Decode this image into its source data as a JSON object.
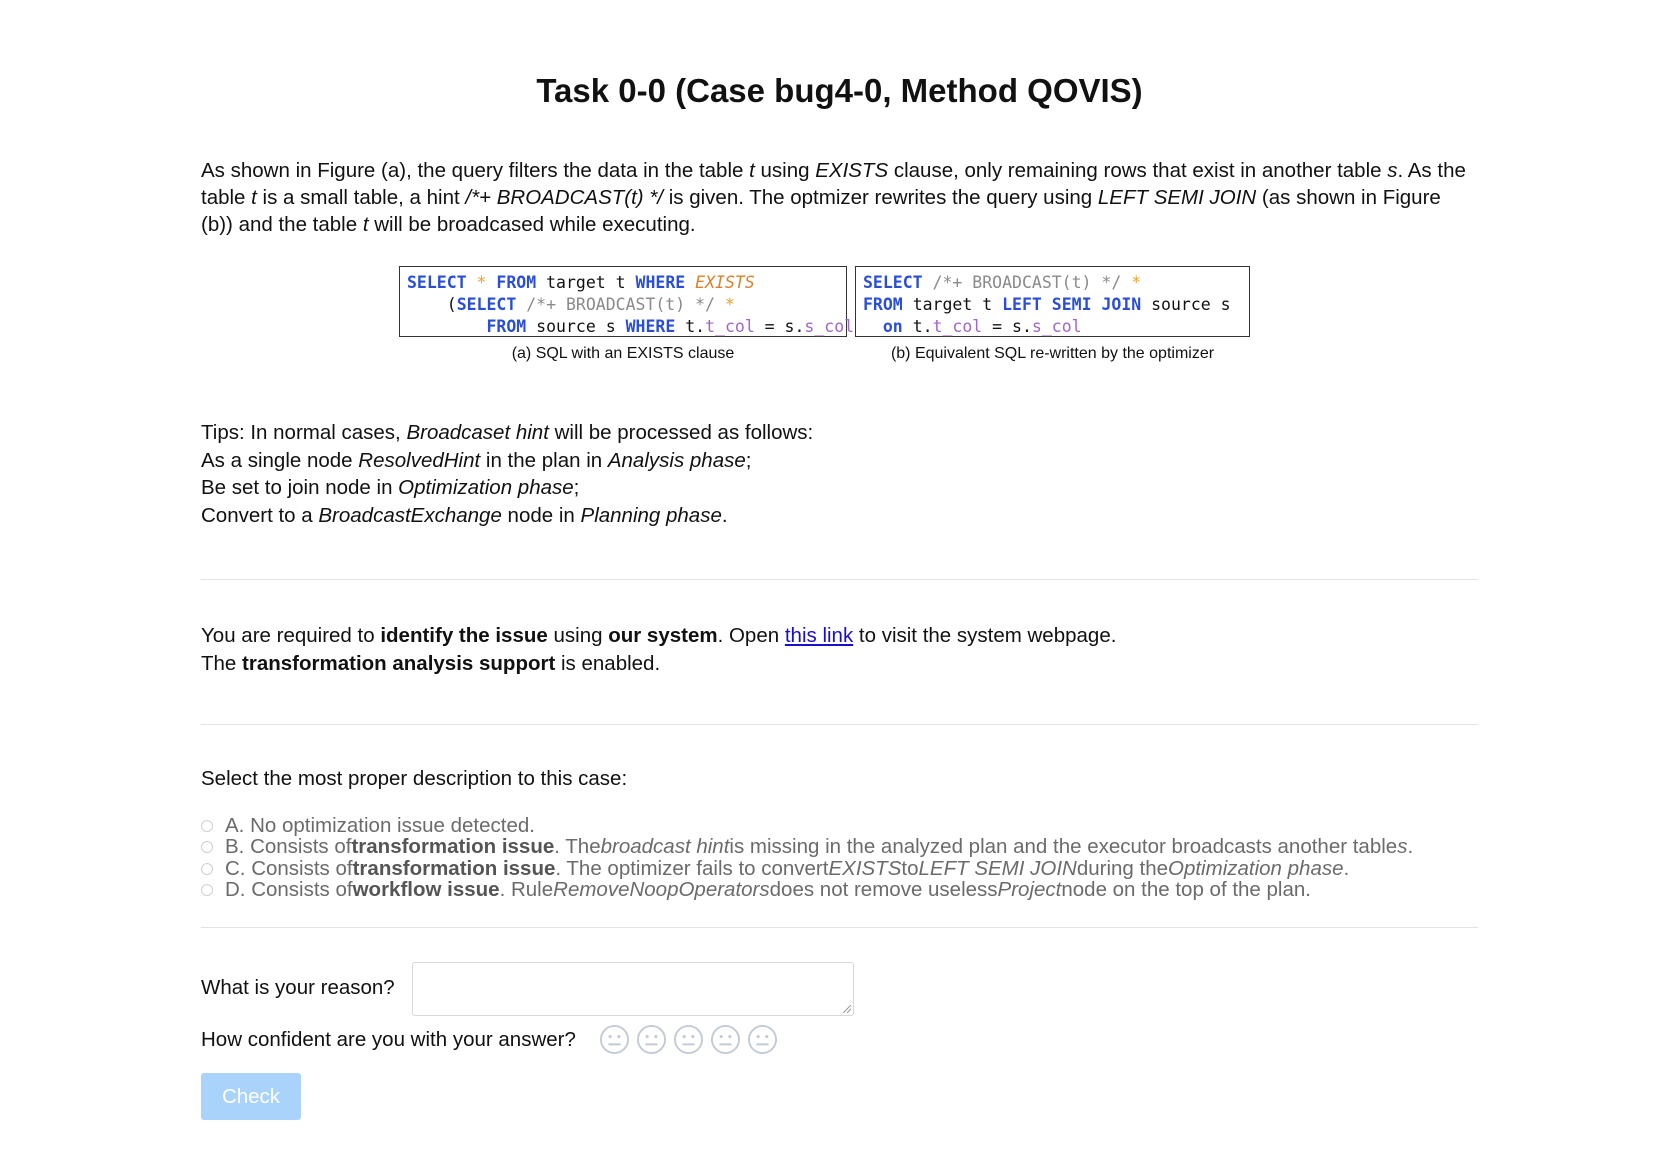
{
  "title": "Task 0-0 (Case bug4-0, Method QOVIS)",
  "intro": {
    "p1": "As shown in Figure (a), the query filters the data in the table ",
    "t1": "t",
    "p2": " using ",
    "exists": "EXISTS",
    "p3": " clause, only remaining rows that exist in another table ",
    "s1": "s",
    "p4": ". As the table ",
    "t2": "t",
    "p5": " is a small table, a hint ",
    "hint": "/*+ BROADCAST(t) */",
    "p6": " is given. The optmizer rewrites the query using ",
    "lsj": "LEFT SEMI JOIN",
    "p7": " (as shown in Figure (b)) and the table ",
    "t3": "t",
    "p8": " will be broadcased while executing."
  },
  "figures": {
    "a": {
      "caption": "(a) SQL with an EXISTS clause",
      "l1_select": "SELECT",
      "l1_star": "*",
      "l1_from": "FROM",
      "l1_target": "target t",
      "l1_where": "WHERE",
      "l1_exists": "EXISTS",
      "l2_open": "(",
      "l2_select": "SELECT",
      "l2_hint": "/*+ BROADCAST(t) */",
      "l2_star": "*",
      "l3_from": "FROM",
      "l3_source": "source s",
      "l3_where": "WHERE",
      "l3_t": "t.",
      "l3_tcol": "t_col",
      "l3_eq": " = s.",
      "l3_scol": "s_col",
      "l3_close": ")"
    },
    "b": {
      "caption": "(b) Equivalent SQL re-written by the optimizer",
      "l1_select": "SELECT",
      "l1_hint": "/*+ BROADCAST(t) */",
      "l1_star": "*",
      "l2_from": "FROM",
      "l2_target": "target t",
      "l2_lsj": "LEFT SEMI JOIN",
      "l2_source": "source s",
      "l3_on": "on",
      "l3_t": "t.",
      "l3_tcol": "t_col",
      "l3_eq": " = s.",
      "l3_scol": "s_col"
    }
  },
  "tips": {
    "l1a": "Tips: In normal cases, ",
    "l1b": "Broadcaset hint",
    "l1c": " will be processed as follows:",
    "l2a": "As a single node ",
    "l2b": "ResolvedHint",
    "l2c": " in the plan in ",
    "l2d": "Analysis phase",
    "l2e": ";",
    "l3a": "Be set to join node in ",
    "l3b": "Optimization phase",
    "l3c": ";",
    "l4a": "Convert to a ",
    "l4b": "BroadcastExchange",
    "l4c": " node in ",
    "l4d": "Planning phase",
    "l4e": "."
  },
  "requirement": {
    "a": "You are required to ",
    "b": "identify the issue",
    "c": " using ",
    "d": "our system",
    "e": ". Open ",
    "link": "this link",
    "f": " to visit the system webpage.",
    "g": "The ",
    "h": "transformation analysis support",
    "i": " is enabled."
  },
  "question": {
    "prompt": "Select the most proper description to this case:",
    "options": [
      {
        "a": "A. No optimization issue detected."
      },
      {
        "a": "B. Consists of ",
        "b": "transformation issue",
        "c": ". The ",
        "d": "broadcast hint",
        "e": " is missing in the analyzed plan and the executor broadcasts another table ",
        "f": "s",
        "g": "."
      },
      {
        "a": "C. Consists of ",
        "b": "transformation issue",
        "c": ". The optimizer fails to convert ",
        "d": "EXISTS",
        "e": " to ",
        "f": "LEFT SEMI JOIN",
        "g": " during the ",
        "h": "Optimization phase",
        "i": "."
      },
      {
        "a": "D. Consists of ",
        "b": "workflow issue",
        "c": ". Rule ",
        "d": "RemoveNoopOperators",
        "e": " does not remove useless ",
        "f": "Project",
        "g": " node on the top of the plan."
      }
    ]
  },
  "reason": {
    "label": "What is your reason?",
    "value": ""
  },
  "confidence": {
    "label": "How confident are you with your answer?",
    "icon": "neutral-face-icon",
    "count": 5
  },
  "check_button": "Check",
  "colors": {
    "keyword": "#2a4fd6",
    "comment": "#8a8a8a",
    "star": "#f0a020",
    "column": "#a066c8",
    "button": "#a9d3fb",
    "link": "#1a0dcc"
  }
}
